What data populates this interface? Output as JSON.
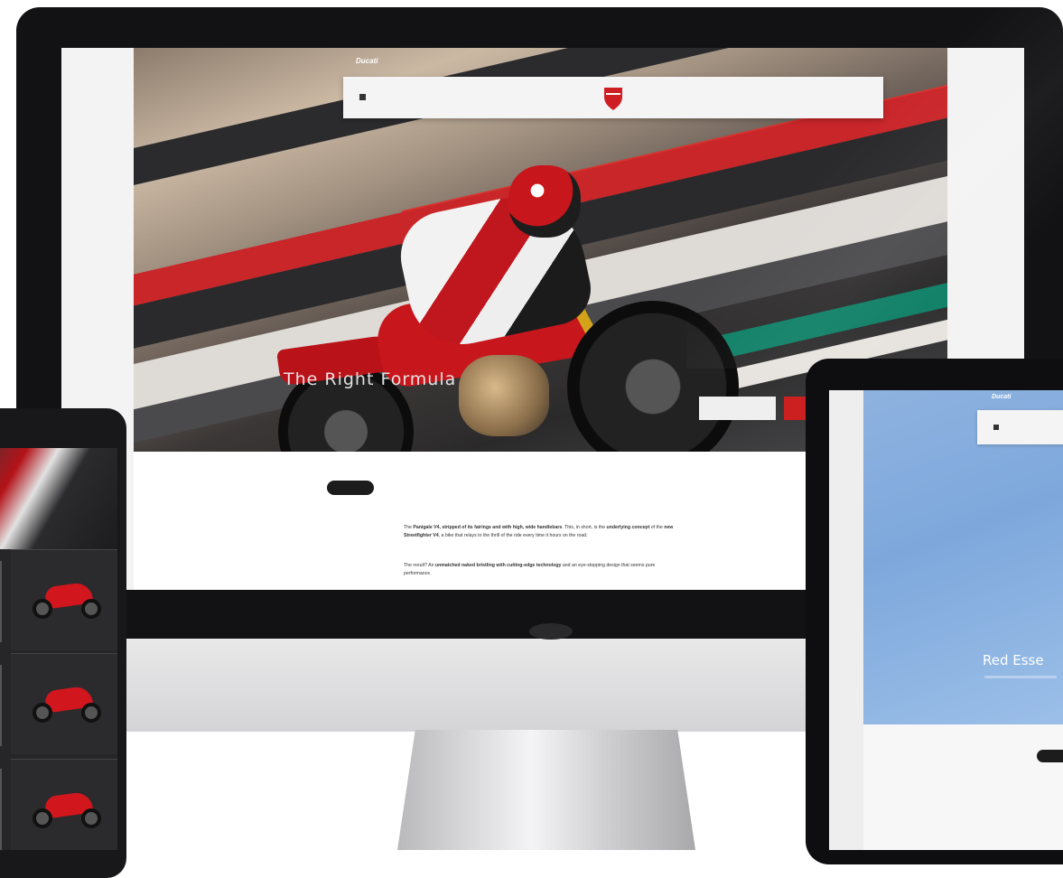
{
  "colors": {
    "brand_red": "#cc1f1f",
    "dark_frame": "#121214",
    "tablet_hero_blue": "#8fb3e0"
  },
  "desktop": {
    "topbar": {
      "logo": "Ducati",
      "left_text": "",
      "right_link_1": "",
      "right_link_2": ""
    },
    "nav": {
      "menu_icon": "menu-icon",
      "items_left": [
        "",
        "",
        ""
      ],
      "items_right": [
        "",
        "",
        ""
      ]
    },
    "hero": {
      "title": "The Right Formula",
      "button_secondary": "",
      "button_primary": ""
    },
    "tabs": {
      "active": "",
      "others": [
        "",
        "",
        "",
        "",
        "",
        ""
      ]
    },
    "content": {
      "paragraph_1_parts": [
        "The ",
        "Panigale V4, stripped of its fairings and with high, wide handlebars",
        ". This, in short, is the ",
        "underlying concept",
        " of the ",
        "new Streetfighter V4",
        ", a bike that relays to the thrill of the ride every time it hours on the road."
      ],
      "paragraph_2_parts": [
        "The result? An ",
        "unmatched naked",
        " ",
        "bristling with cutting-edge technology",
        " and an eye-stopping design that seems pure performance."
      ]
    }
  },
  "tablet": {
    "logo": "Ducati",
    "nav_icon": "menu-icon",
    "kicker": "",
    "hero_title": "Red Esse"
  },
  "phone": {
    "cards": [
      "motorcycle-card",
      "motorcycle-card",
      "motorcycle-card"
    ]
  }
}
